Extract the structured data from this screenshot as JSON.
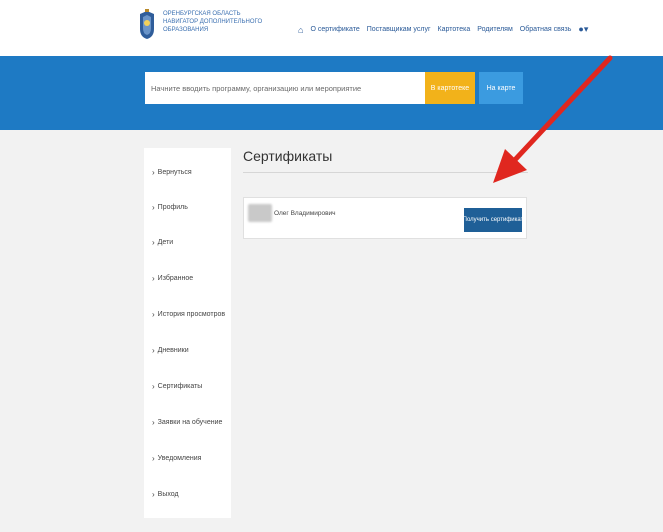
{
  "header": {
    "logo_lines": [
      "Оренбургская область",
      "Навигатор дополнительного",
      "образования"
    ],
    "nav": {
      "home_icon": "home-icon",
      "items": [
        "О сертификате",
        "Поставщикам услуг",
        "Картотека",
        "Родителям",
        "Обратная связь"
      ],
      "user_icon": "user-icon",
      "user_caret": "▾"
    }
  },
  "search": {
    "placeholder": "Начните вводить программу, организацию или мероприятие",
    "catalog_button": "В картотеке",
    "map_button": "На карте"
  },
  "sidebar": {
    "chevron": "›",
    "items": [
      "Вернуться",
      "Профиль",
      "Дети",
      "Избранное",
      "История просмотров",
      "Дневники",
      "Сертификаты",
      "Заявки на обучение",
      "Уведомления",
      "Выход"
    ]
  },
  "main": {
    "title": "Сертификаты",
    "card": {
      "name": "Олег Владимирович",
      "button": "Получить сертификат"
    }
  },
  "colors": {
    "band": "#1e7ac4",
    "catalog_button": "#f2b21a",
    "map_button": "#3b9be0",
    "certificate_button": "#1f5f97",
    "arrow": "#e0271f"
  }
}
